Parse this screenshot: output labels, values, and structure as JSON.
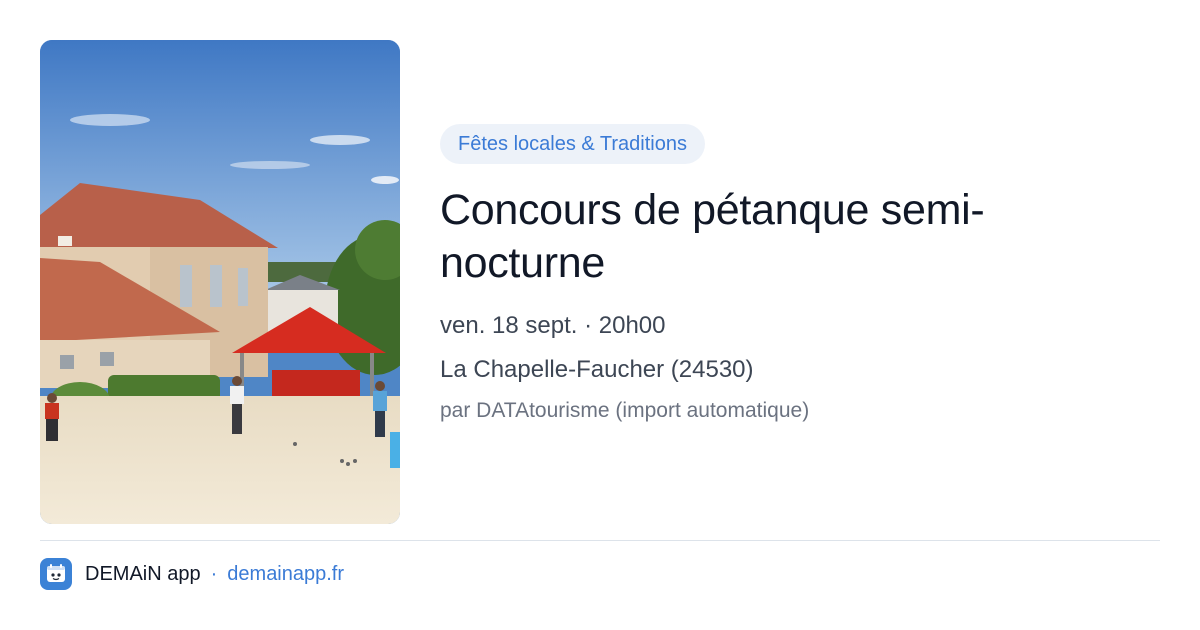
{
  "event": {
    "category": "Fêtes locales & Traditions",
    "title": "Concours de pétanque semi-nocturne",
    "date_time": "ven. 18 sept. · 20h00",
    "location": "La Chapelle-Faucher (24530)",
    "source": "par DATAtourisme (import automatique)"
  },
  "footer": {
    "app_name": "DEMAiN app",
    "separator": "·",
    "link": "demainapp.fr",
    "icon": "app-logo-icon"
  },
  "colors": {
    "accent": "#3b7bd6",
    "pill_bg": "#edf2f9",
    "title": "#111827",
    "meta": "#3d4654",
    "muted": "#6b7280"
  }
}
